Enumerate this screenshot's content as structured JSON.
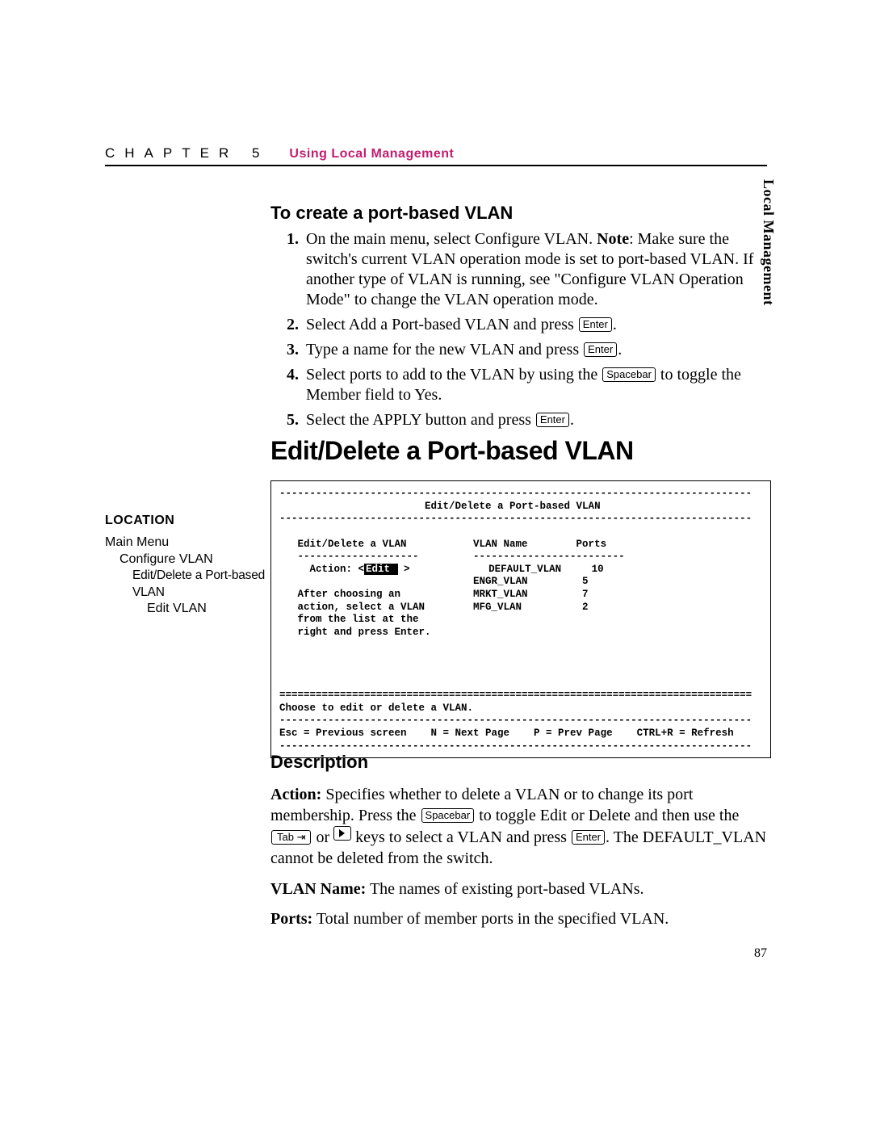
{
  "header": {
    "chapter": "CHAPTER 5",
    "title": "Using Local Management"
  },
  "side_tab": "Local Management",
  "section1": {
    "title": "To create a port-based VLAN",
    "steps": [
      {
        "pre": "On the main menu, select Configure VLAN. ",
        "bold": "Note",
        "post": ": Make sure the switch's current VLAN operation mode is set to port-based VLAN. If another type of VLAN is running, see \"Configure VLAN Operation Mode\" to change the VLAN operation mode."
      },
      {
        "pre": "Select Add a Port-based VLAN and press ",
        "key": "Enter",
        "post": "."
      },
      {
        "pre": "Type a name for the new VLAN and press ",
        "key": "Enter",
        "post": "."
      },
      {
        "pre": "Select ports to add to the VLAN by using the ",
        "key": "Spacebar",
        "post": " to toggle the Member field to Yes."
      },
      {
        "pre": "Select the APPLY button and press ",
        "key": "Enter",
        "post": "."
      }
    ]
  },
  "h1": "Edit/Delete a Port-based VLAN",
  "location": {
    "title": "LOCATION",
    "l1": "Main Menu",
    "l2": "Configure VLAN",
    "l3": "Edit/Delete a Port-based VLAN",
    "l4": "Edit VLAN"
  },
  "terminal": {
    "dash_top": "------------------------------------------------------------------------------",
    "title": "                        Edit/Delete a Port-based VLAN",
    "left_head": "   Edit/Delete a VLAN           VLAN Name        Ports",
    "left_rule": "   --------------------         -------------------------",
    "action_pre": "     Action: <",
    "action_sel": "Edit ",
    "action_post": " >             DEFAULT_VLAN     10",
    "row2": "                                ENGR_VLAN         5",
    "row3": "   After choosing an            MRKT_VLAN         7",
    "row4": "   action, select a VLAN        MFG_VLAN          2",
    "row5": "   from the list at the",
    "row6": "   right and press Enter.",
    "eq_rule": "==============================================================================",
    "hint": "Choose to edit or delete a VLAN.",
    "foot": "Esc = Previous screen    N = Next Page    P = Prev Page    CTRL+R = Refresh"
  },
  "description": {
    "title": "Description",
    "action_label": "Action:",
    "action_p1": " Specifies whether to delete a VLAN or to change its port membership. Press the ",
    "key_spacebar": "Spacebar",
    "action_p2": " to toggle Edit or Delete and then use the ",
    "key_tab": "Tab ⇥",
    "action_mid": " or ",
    "action_p3": " keys to select a VLAN and press ",
    "key_enter": "Enter",
    "action_p4": ". The DEFAULT_VLAN cannot be deleted from the switch.",
    "vlan_label": "VLAN Name:",
    "vlan_text": " The names of existing port-based VLANs.",
    "ports_label": "Ports:",
    "ports_text": " Total number of member ports in the specified VLAN."
  },
  "page_number": "87"
}
